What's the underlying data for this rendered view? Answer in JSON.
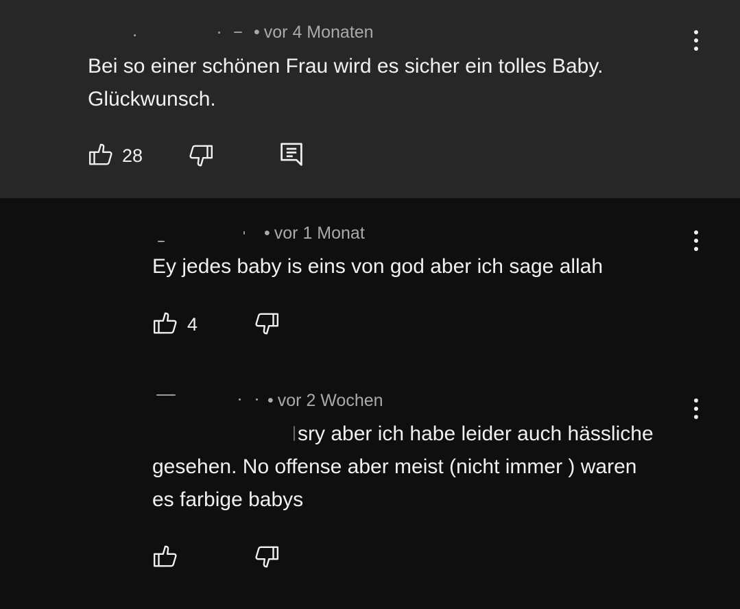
{
  "comments": [
    {
      "time_label": "vor 4 Monaten",
      "text_line1": "Bei so einer schönen Frau wird es sicher ein tolles Baby.",
      "text_line2": "Glückwunsch.",
      "like_count": "28",
      "has_reply_icon": true
    },
    {
      "time_label": "vor 1 Monat",
      "text_line1": "Ey jedes baby is eins von god aber ich sage allah",
      "like_count": "4"
    },
    {
      "time_label": "vor 2 Wochen",
      "text_line1": "sry aber ich habe leider auch hässliche",
      "text_line2": "gesehen. No offense aber meist (nicht immer ) waren",
      "text_line3": "es farbige babys",
      "like_count": ""
    }
  ],
  "separator": "•",
  "colors": {
    "parent_background": "#272727",
    "page_background": "#0f0f0f",
    "text": "#f1f1f1",
    "meta_text": "#aaaaaa"
  },
  "icons": [
    "like-icon",
    "dislike-icon",
    "reply-icon",
    "more-options-icon"
  ]
}
